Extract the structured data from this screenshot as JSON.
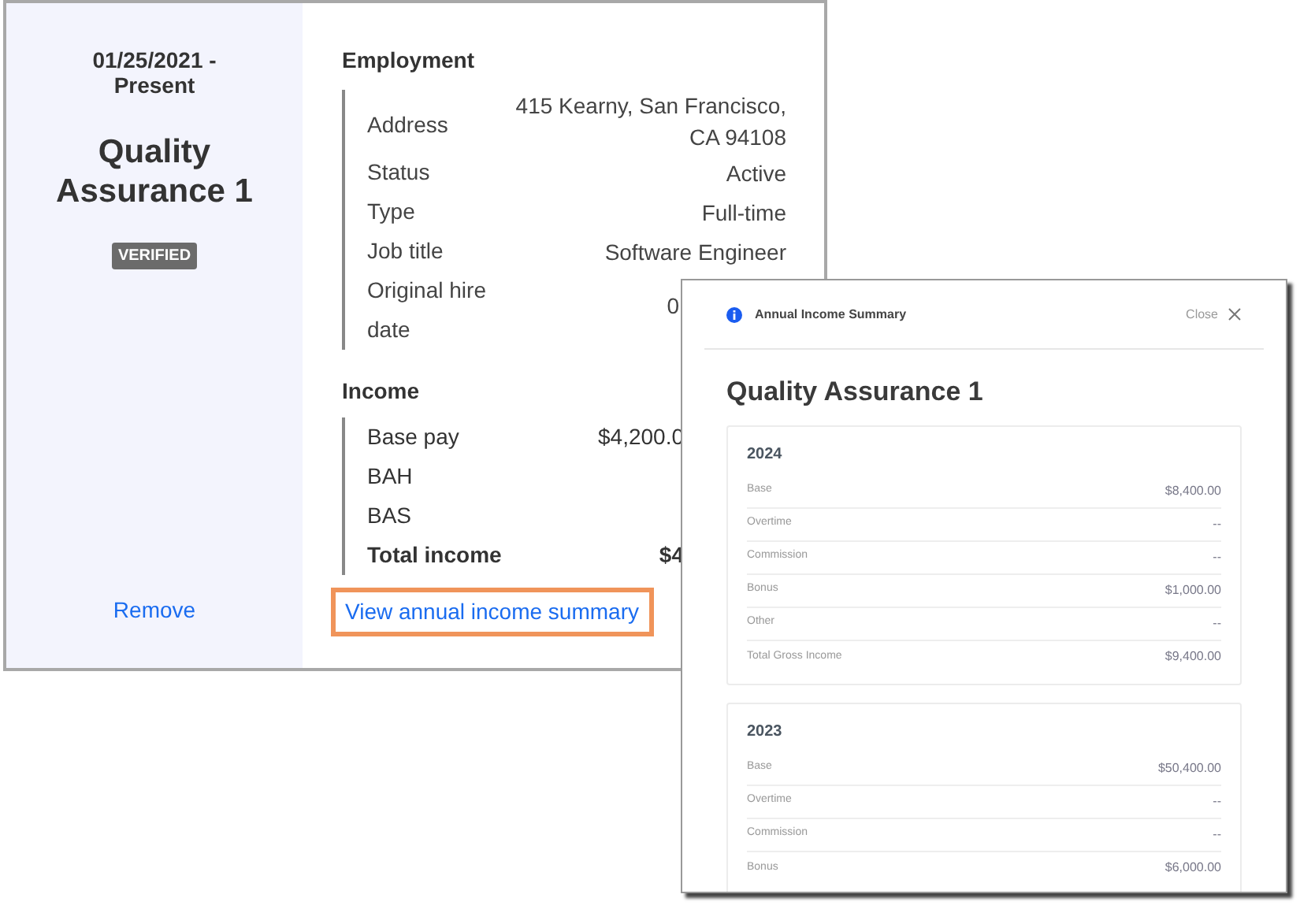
{
  "card": {
    "period": "01/25/2021 - Present",
    "title": "Quality Assurance 1",
    "badge": "VERIFIED",
    "remove_link": "Remove",
    "employment": {
      "heading": "Employment",
      "rows": [
        {
          "label": "Address",
          "value": "415 Kearny, San Francisco, CA 94108",
          "covered": false
        },
        {
          "label": "Status",
          "value": "Active",
          "covered": false
        },
        {
          "label": "Type",
          "value": "Full-time",
          "covered": false
        },
        {
          "label": "Job title",
          "value": "Software Engineer",
          "covered": false
        },
        {
          "label": "Original hire date",
          "value": "0",
          "covered": true
        }
      ]
    },
    "income": {
      "heading": "Income",
      "rows": [
        {
          "label": "Base pay",
          "value": "$4,200.0",
          "bold": false
        },
        {
          "label": "BAH",
          "value": "",
          "bold": false
        },
        {
          "label": "BAS",
          "value": "",
          "bold": false
        },
        {
          "label": "Total income",
          "value": "$4",
          "bold": true
        }
      ]
    },
    "summary_link": "View annual income summary"
  },
  "modal": {
    "header": "Annual Income Summary",
    "close": "Close",
    "title": "Quality Assurance 1",
    "years": [
      {
        "year": "2024",
        "rows": [
          {
            "label": "Base",
            "value": "$8,400.00"
          },
          {
            "label": "Overtime",
            "value": "--"
          },
          {
            "label": "Commission",
            "value": "--"
          },
          {
            "label": "Bonus",
            "value": "$1,000.00"
          },
          {
            "label": "Other",
            "value": "--"
          },
          {
            "label": "Total Gross Income",
            "value": "$9,400.00"
          }
        ]
      },
      {
        "year": "2023",
        "rows": [
          {
            "label": "Base",
            "value": "$50,400.00"
          },
          {
            "label": "Overtime",
            "value": "--"
          },
          {
            "label": "Commission",
            "value": "--"
          },
          {
            "label": "Bonus",
            "value": "$6,000.00"
          }
        ]
      }
    ]
  }
}
